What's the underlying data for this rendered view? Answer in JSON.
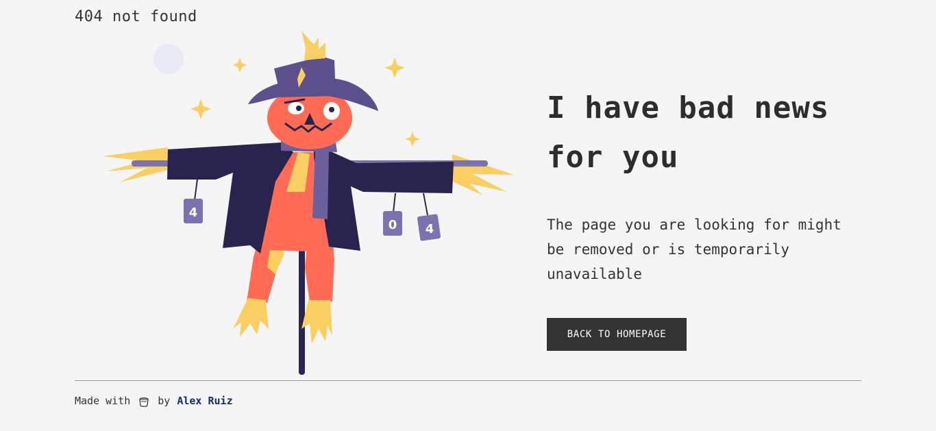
{
  "page": {
    "top_label": "404 not found",
    "headline": "I have bad news for you",
    "description": "The page you are looking for might be removed or is temporarily unavailable",
    "back_button_label": "BACK TO HOMEPAGE"
  },
  "illustration": {
    "can_labels": [
      "4",
      "0",
      "4"
    ]
  },
  "footer": {
    "made_with": "Made with",
    "by": "by",
    "author": "Alex Ruiz",
    "icon": "coffee-cup-icon"
  },
  "colors": {
    "background": "#f5f5f5",
    "text": "#333333",
    "button_bg": "#333333",
    "button_text": "#ffffff",
    "author_link": "#1b2a6b"
  }
}
